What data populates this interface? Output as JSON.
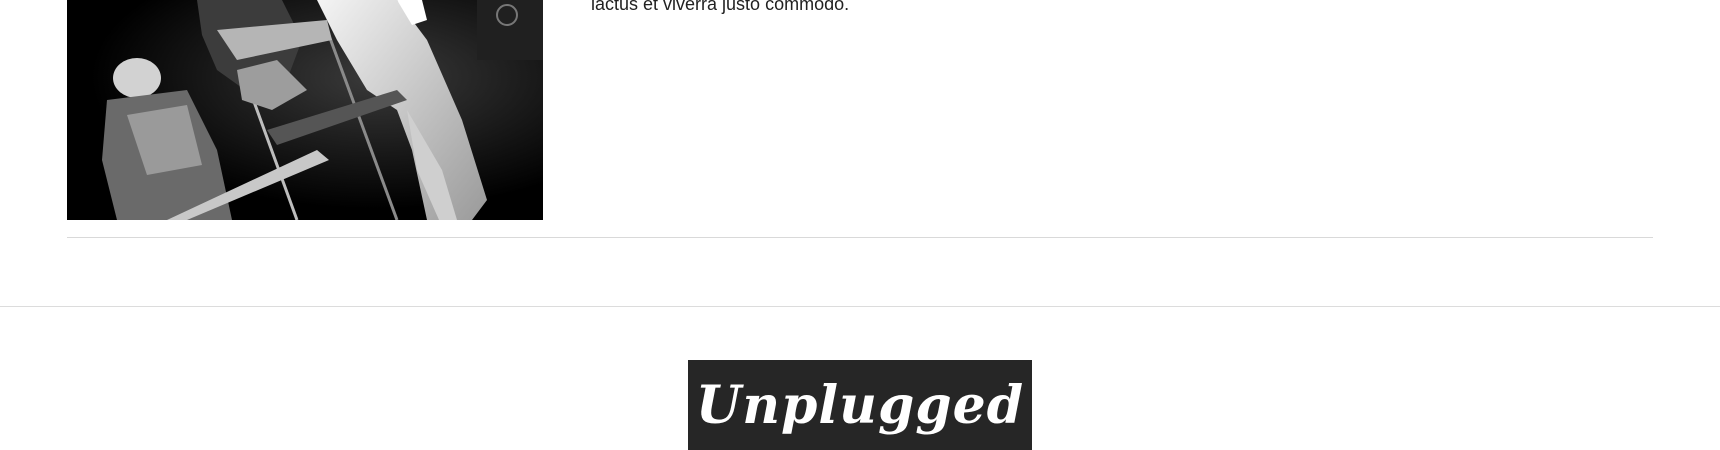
{
  "post": {
    "image_alt": "Black and white photo of a band performing live on stage",
    "text_tail": "lactus et viverra justo commodo."
  },
  "footer": {
    "logo_text": "Unplugged",
    "logo_bg": "#262626",
    "logo_fg": "#ffffff"
  }
}
